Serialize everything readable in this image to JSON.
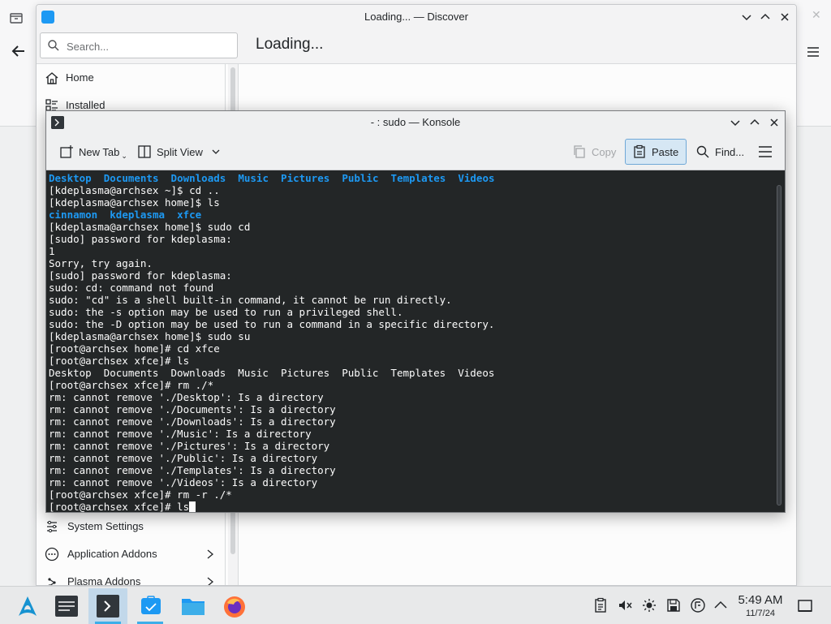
{
  "discover": {
    "window_title": "Loading... — Discover",
    "search_placeholder": "Search...",
    "page_heading": "Loading...",
    "nav_top": [
      {
        "label": "Home",
        "icon": "home-icon"
      },
      {
        "label": "Installed",
        "icon": "installed-list-icon"
      }
    ],
    "nav_bottom": [
      {
        "label": "System Settings",
        "icon": "settings-icon"
      },
      {
        "label": "Application Addons",
        "icon": "more-dots-icon"
      },
      {
        "label": "Plasma Addons",
        "icon": "plasma-icon"
      }
    ]
  },
  "konsole": {
    "window_title": "- : sudo — Konsole",
    "toolbar": {
      "new_tab": "New Tab",
      "split_view": "Split View",
      "copy": "Copy",
      "paste": "Paste",
      "find": "Find..."
    },
    "lines": [
      [
        {
          "t": "Desktop",
          "c": "blue"
        },
        {
          "t": "  "
        },
        {
          "t": "Documents",
          "c": "blue"
        },
        {
          "t": "  "
        },
        {
          "t": "Downloads",
          "c": "blue"
        },
        {
          "t": "  "
        },
        {
          "t": "Music",
          "c": "blue"
        },
        {
          "t": "  "
        },
        {
          "t": "Pictures",
          "c": "blue"
        },
        {
          "t": "  "
        },
        {
          "t": "Public",
          "c": "blue"
        },
        {
          "t": "  "
        },
        {
          "t": "Templates",
          "c": "blue"
        },
        {
          "t": "  "
        },
        {
          "t": "Videos",
          "c": "blue"
        }
      ],
      [
        {
          "t": "[kdeplasma@archsex ~]$ cd .."
        }
      ],
      [
        {
          "t": "[kdeplasma@archsex home]$ ls"
        }
      ],
      [
        {
          "t": "cinnamon",
          "c": "blue"
        },
        {
          "t": "  "
        },
        {
          "t": "kdeplasma",
          "c": "blue"
        },
        {
          "t": "  "
        },
        {
          "t": "xfce",
          "c": "blue"
        }
      ],
      [
        {
          "t": "[kdeplasma@archsex home]$ sudo cd"
        }
      ],
      [
        {
          "t": "[sudo] password for kdeplasma:"
        }
      ],
      [
        {
          "t": "1"
        }
      ],
      [
        {
          "t": "Sorry, try again."
        }
      ],
      [
        {
          "t": "[sudo] password for kdeplasma:"
        }
      ],
      [
        {
          "t": "sudo: cd: command not found"
        }
      ],
      [
        {
          "t": "sudo: \"cd\" is a shell built-in command, it cannot be run directly."
        }
      ],
      [
        {
          "t": "sudo: the -s option may be used to run a privileged shell."
        }
      ],
      [
        {
          "t": "sudo: the -D option may be used to run a command in a specific directory."
        }
      ],
      [
        {
          "t": "[kdeplasma@archsex home]$ sudo su"
        }
      ],
      [
        {
          "t": "[root@archsex home]# cd xfce"
        }
      ],
      [
        {
          "t": "[root@archsex xfce]# ls"
        }
      ],
      [
        {
          "t": "Desktop  Documents  Downloads  Music  Pictures  Public  Templates  Videos"
        }
      ],
      [
        {
          "t": "[root@archsex xfce]# rm ./*"
        }
      ],
      [
        {
          "t": "rm: cannot remove './Desktop': Is a directory"
        }
      ],
      [
        {
          "t": "rm: cannot remove './Documents': Is a directory"
        }
      ],
      [
        {
          "t": "rm: cannot remove './Downloads': Is a directory"
        }
      ],
      [
        {
          "t": "rm: cannot remove './Music': Is a directory"
        }
      ],
      [
        {
          "t": "rm: cannot remove './Pictures': Is a directory"
        }
      ],
      [
        {
          "t": "rm: cannot remove './Public': Is a directory"
        }
      ],
      [
        {
          "t": "rm: cannot remove './Templates': Is a directory"
        }
      ],
      [
        {
          "t": "rm: cannot remove './Videos': Is a directory"
        }
      ],
      [
        {
          "t": "[root@archsex xfce]# rm -r ./*"
        }
      ],
      [
        {
          "t": "[root@archsex xfce]# ls"
        }
      ]
    ]
  },
  "taskbar": {
    "items": [
      {
        "name": "app-launcher-arch-icon"
      },
      {
        "name": "system-monitor-icon"
      },
      {
        "name": "konsole-icon"
      },
      {
        "name": "discover-icon"
      },
      {
        "name": "file-manager-icon"
      },
      {
        "name": "firefox-icon"
      }
    ],
    "time": "5:49 AM",
    "date": "11/7/24"
  },
  "colors": {
    "accent": "#3daee9",
    "terminal_bg": "#232627",
    "terminal_dir": "#1d99f3"
  }
}
